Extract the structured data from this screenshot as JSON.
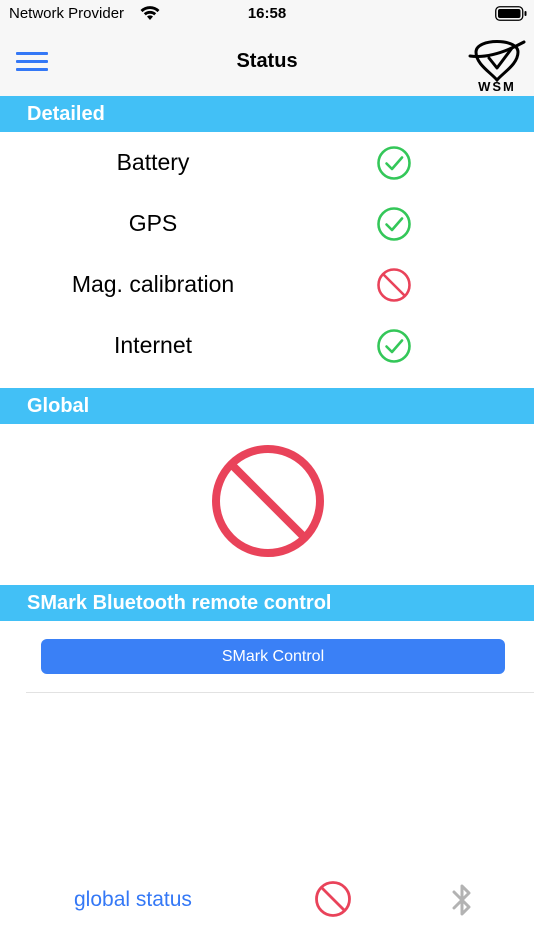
{
  "status_bar": {
    "carrier": "Network Provider",
    "time": "16:58"
  },
  "nav": {
    "title": "Status",
    "logo_text": "WSM"
  },
  "sections": {
    "detailed": "Detailed",
    "global": "Global",
    "remote": "SMark Bluetooth remote control"
  },
  "detailed_items": [
    {
      "label": "Battery",
      "state": "ok",
      "icon": "check-circle-icon"
    },
    {
      "label": "GPS",
      "state": "ok",
      "icon": "check-circle-icon"
    },
    {
      "label": "Mag. calibration",
      "state": "error",
      "icon": "prohibited-icon"
    },
    {
      "label": "Internet",
      "state": "ok",
      "icon": "check-circle-icon"
    }
  ],
  "global_status": {
    "state": "error",
    "icon": "prohibited-icon"
  },
  "remote": {
    "button_label": "SMark Control"
  },
  "tab_bar": {
    "global_label": "global status",
    "status_icon": "prohibited-icon",
    "bluetooth_icon": "bluetooth-icon"
  },
  "colors": {
    "accent": "#3478f6",
    "header": "#42c0f6",
    "ok": "#34c759",
    "error": "#e9435a",
    "button": "#3a80f6"
  }
}
